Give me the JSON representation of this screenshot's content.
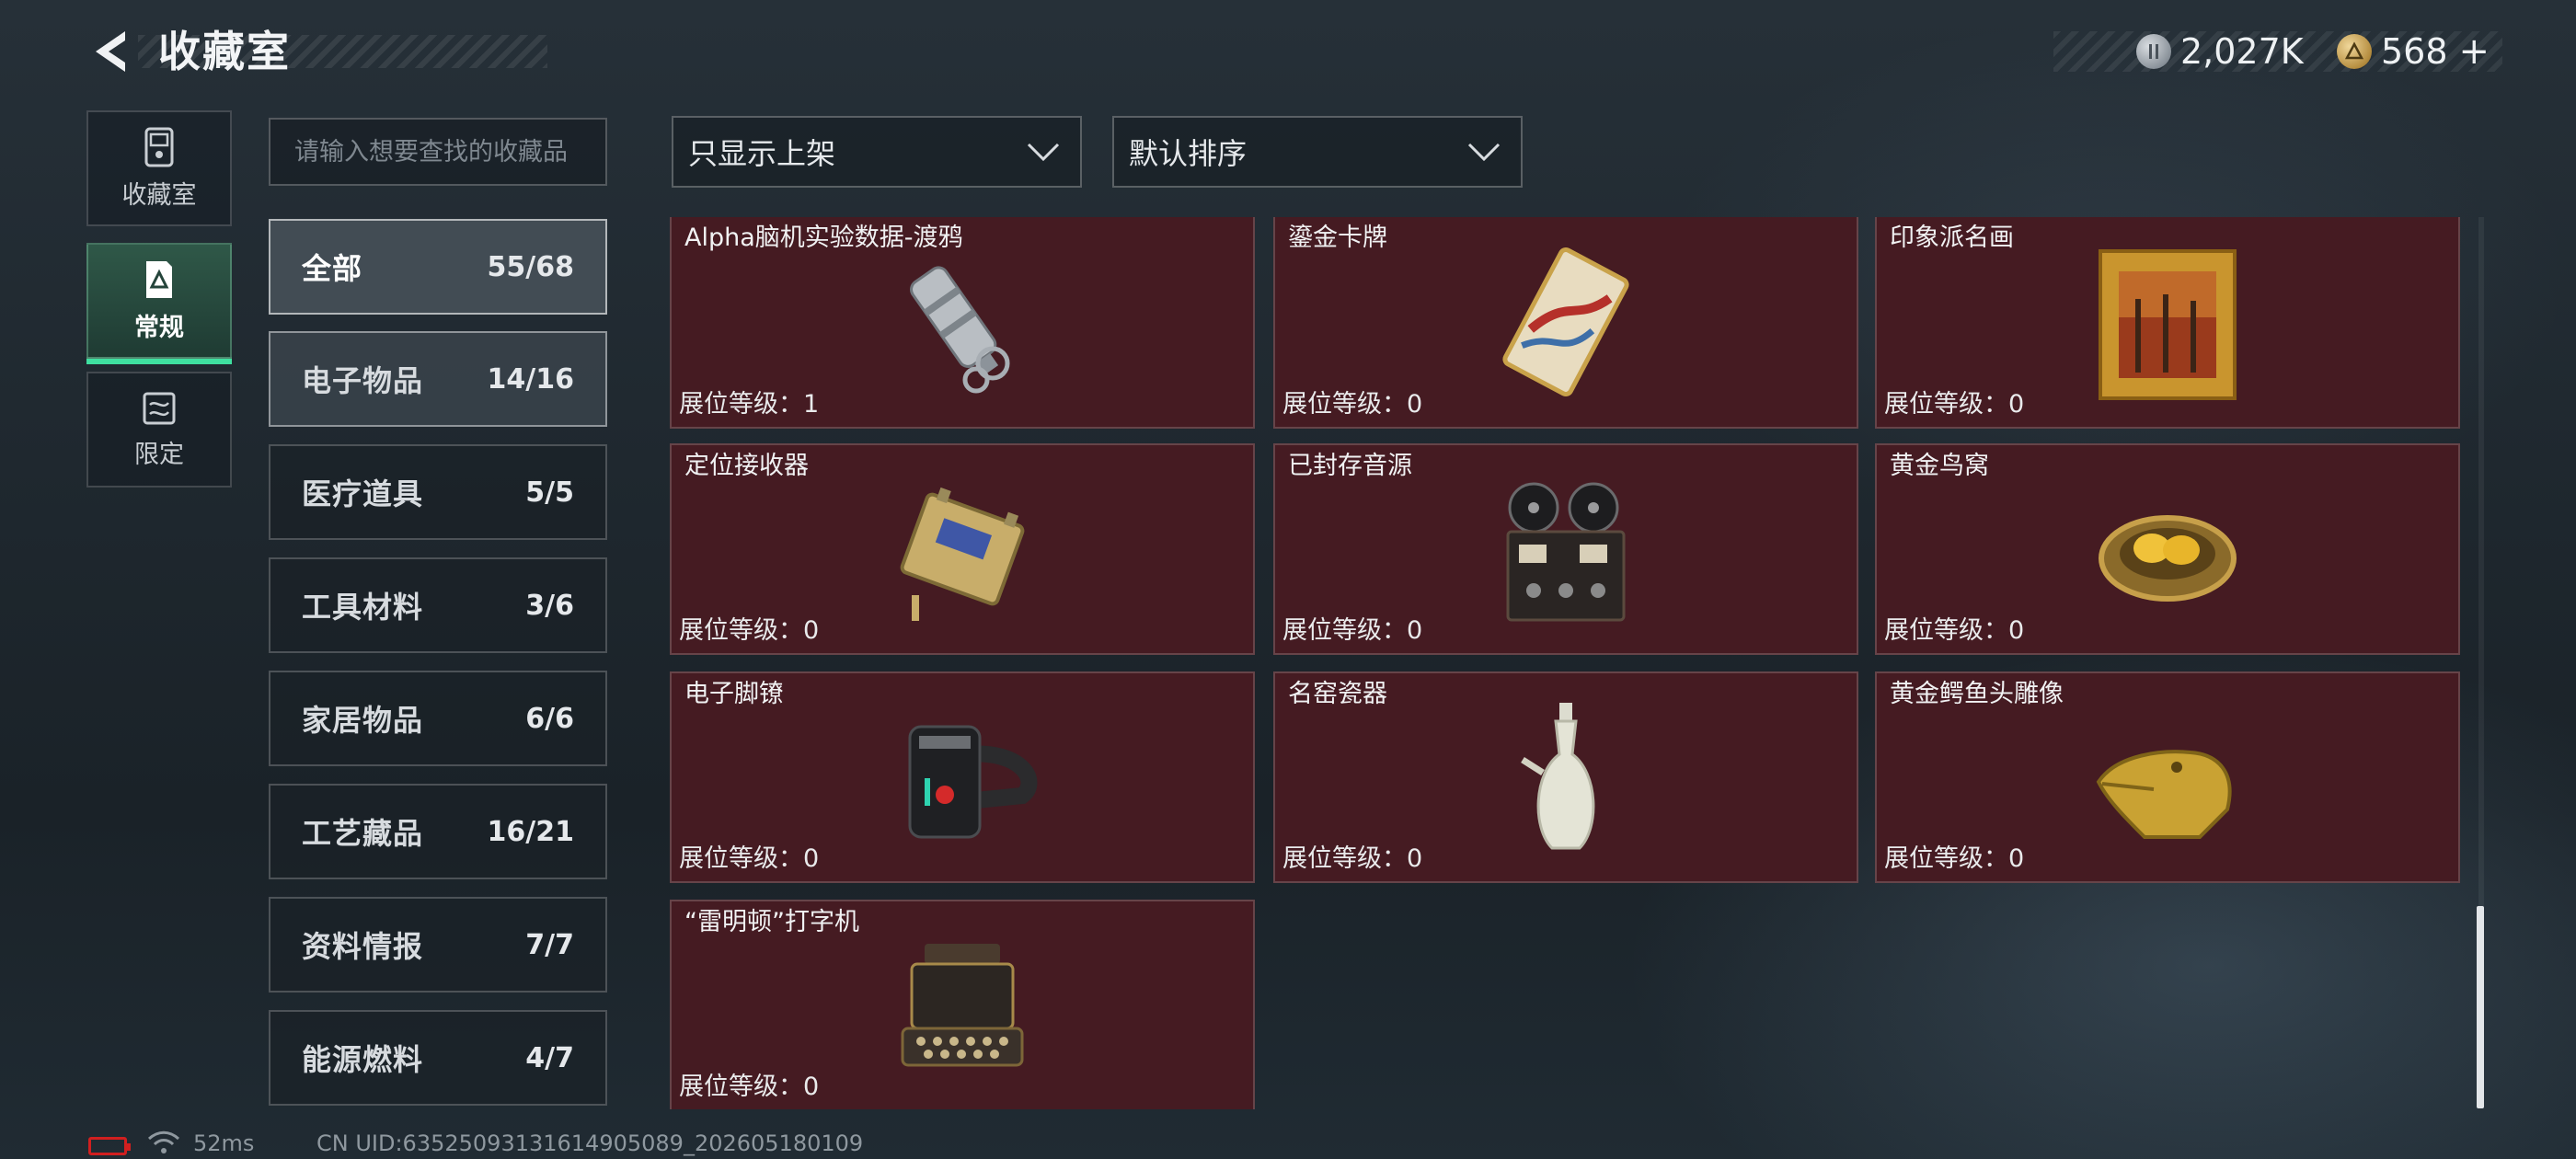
{
  "header": {
    "title": "收藏室",
    "silver_amount": "2,027K",
    "gold_amount": "568",
    "plus_label": "+"
  },
  "side_tabs": [
    {
      "label": "收藏室",
      "icon": "collection-room-icon"
    },
    {
      "label": "常规",
      "icon": "regular-icon"
    },
    {
      "label": "限定",
      "icon": "limited-icon"
    }
  ],
  "search": {
    "placeholder": "请输入想要查找的收藏品",
    "value": ""
  },
  "filters": {
    "shelf_filter": "只显示上架",
    "sort_order": "默认排序"
  },
  "categories": [
    {
      "name": "全部",
      "count": "55/68"
    },
    {
      "name": "电子物品",
      "count": "14/16"
    },
    {
      "name": "医疗道具",
      "count": "5/5"
    },
    {
      "name": "工具材料",
      "count": "3/6"
    },
    {
      "name": "家居物品",
      "count": "6/6"
    },
    {
      "name": "工艺藏品",
      "count": "16/21"
    },
    {
      "name": "资料情报",
      "count": "7/7"
    },
    {
      "name": "能源燃料",
      "count": "4/7"
    }
  ],
  "items": [
    {
      "name": "Alpha脑机实验数据-渡鸦",
      "level": "展位等级：1",
      "icon": "usb-drive-icon"
    },
    {
      "name": "鎏金卡牌",
      "level": "展位等级：0",
      "icon": "gilded-card-icon"
    },
    {
      "name": "印象派名画",
      "level": "展位等级：0",
      "icon": "framed-painting-icon"
    },
    {
      "name": "定位接收器",
      "level": "展位等级：0",
      "icon": "locator-receiver-icon"
    },
    {
      "name": "已封存音源",
      "level": "展位等级：0",
      "icon": "reel-recorder-icon"
    },
    {
      "name": "黄金鸟窝",
      "level": "展位等级：0",
      "icon": "golden-nest-icon"
    },
    {
      "name": "电子脚镣",
      "level": "展位等级：0",
      "icon": "ankle-monitor-icon"
    },
    {
      "name": "名窑瓷器",
      "level": "展位等级：0",
      "icon": "porcelain-vase-icon"
    },
    {
      "name": "黄金鳄鱼头雕像",
      "level": "展位等级：0",
      "icon": "gold-crocodile-icon"
    },
    {
      "name": "“雷明顿”打字机",
      "level": "展位等级：0",
      "icon": "typewriter-icon"
    }
  ],
  "status_bar": {
    "ping": "52ms",
    "uid": "CN UID:63525093131614905089_202605180109"
  },
  "colors": {
    "card_bg": "#451b22",
    "active_tab": "#2f5848",
    "active_underline": "#3fe0a0",
    "battery": "#d11f1f"
  }
}
